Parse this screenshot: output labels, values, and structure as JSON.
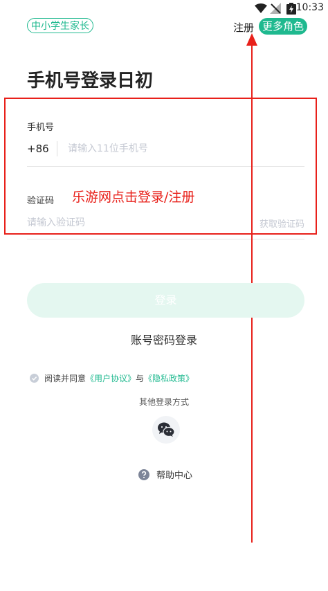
{
  "status_bar": {
    "time": "10:33"
  },
  "header": {
    "role_tag": "中小学生家长",
    "register": "注册",
    "more_roles": "更多角色"
  },
  "title": "手机号登录日初",
  "phone": {
    "label": "手机号",
    "country_code": "+86",
    "placeholder": "请输入11位手机号"
  },
  "code": {
    "label": "验证码",
    "placeholder": "请输入验证码",
    "get_code": "获取验证码"
  },
  "annotation": {
    "text": "乐游网点击登录/注册",
    "color": "#e8201a"
  },
  "login_button": "登录",
  "password_login": "账号密码登录",
  "agreement": {
    "prefix": "阅读并同意",
    "user_agreement": "《用户协议》",
    "and": "与",
    "privacy_policy": "《隐私政策》"
  },
  "other_methods": "其他登录方式",
  "help_center": "帮助中心",
  "colors": {
    "accent": "#1fb98f",
    "annotation": "#e8201a"
  }
}
